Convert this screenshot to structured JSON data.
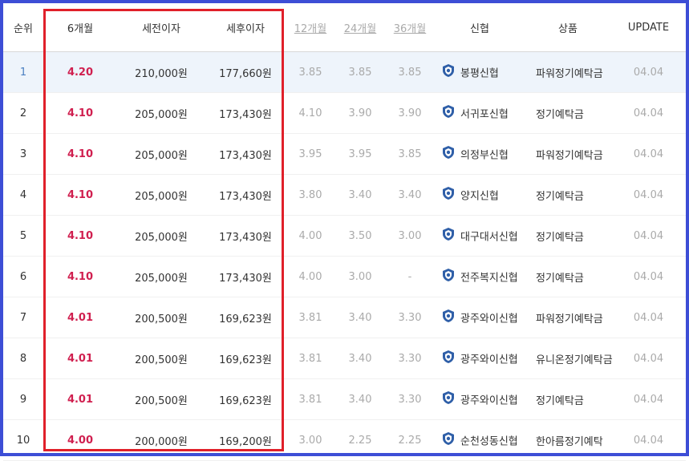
{
  "colors": {
    "frame": "#3d4ed6",
    "highlight_box": "#e0202a",
    "rate": "#d01f4f",
    "rank_active": "#4a7fc1",
    "muted": "#aaaaaa"
  },
  "headers": {
    "rank": "순위",
    "m6": "6개월",
    "pretax": "세전이자",
    "aftertax": "세후이자",
    "m12": "12개월",
    "m24": "24개월",
    "m36": "36개월",
    "bank": "신협",
    "product": "상품",
    "update": "UPDATE"
  },
  "bank_logo_icon": "credit-union-logo-icon",
  "rows": [
    {
      "rank": "1",
      "m6": "4.20",
      "pretax": "210,000원",
      "aftertax": "177,660원",
      "m12": "3.85",
      "m24": "3.85",
      "m36": "3.85",
      "bank": "봉평신협",
      "product": "파워정기예탁금",
      "update": "04.04"
    },
    {
      "rank": "2",
      "m6": "4.10",
      "pretax": "205,000원",
      "aftertax": "173,430원",
      "m12": "4.10",
      "m24": "3.90",
      "m36": "3.90",
      "bank": "서귀포신협",
      "product": "정기예탁금",
      "update": "04.04"
    },
    {
      "rank": "3",
      "m6": "4.10",
      "pretax": "205,000원",
      "aftertax": "173,430원",
      "m12": "3.95",
      "m24": "3.95",
      "m36": "3.85",
      "bank": "의정부신협",
      "product": "파워정기예탁금",
      "update": "04.04"
    },
    {
      "rank": "4",
      "m6": "4.10",
      "pretax": "205,000원",
      "aftertax": "173,430원",
      "m12": "3.80",
      "m24": "3.40",
      "m36": "3.40",
      "bank": "양지신협",
      "product": "정기예탁금",
      "update": "04.04"
    },
    {
      "rank": "5",
      "m6": "4.10",
      "pretax": "205,000원",
      "aftertax": "173,430원",
      "m12": "4.00",
      "m24": "3.50",
      "m36": "3.00",
      "bank": "대구대서신협",
      "product": "정기예탁금",
      "update": "04.04"
    },
    {
      "rank": "6",
      "m6": "4.10",
      "pretax": "205,000원",
      "aftertax": "173,430원",
      "m12": "4.00",
      "m24": "3.00",
      "m36": "-",
      "bank": "전주복지신협",
      "product": "정기예탁금",
      "update": "04.04"
    },
    {
      "rank": "7",
      "m6": "4.01",
      "pretax": "200,500원",
      "aftertax": "169,623원",
      "m12": "3.81",
      "m24": "3.40",
      "m36": "3.30",
      "bank": "광주와이신협",
      "product": "파워정기예탁금",
      "update": "04.04"
    },
    {
      "rank": "8",
      "m6": "4.01",
      "pretax": "200,500원",
      "aftertax": "169,623원",
      "m12": "3.81",
      "m24": "3.40",
      "m36": "3.30",
      "bank": "광주와이신협",
      "product": "유니온정기예탁금",
      "update": "04.04"
    },
    {
      "rank": "9",
      "m6": "4.01",
      "pretax": "200,500원",
      "aftertax": "169,623원",
      "m12": "3.81",
      "m24": "3.40",
      "m36": "3.30",
      "bank": "광주와이신협",
      "product": "정기예탁금",
      "update": "04.04"
    },
    {
      "rank": "10",
      "m6": "4.00",
      "pretax": "200,000원",
      "aftertax": "169,200원",
      "m12": "3.00",
      "m24": "2.25",
      "m36": "2.25",
      "bank": "순천성동신협",
      "product": "한아름정기예탁",
      "update": "04.04"
    }
  ]
}
